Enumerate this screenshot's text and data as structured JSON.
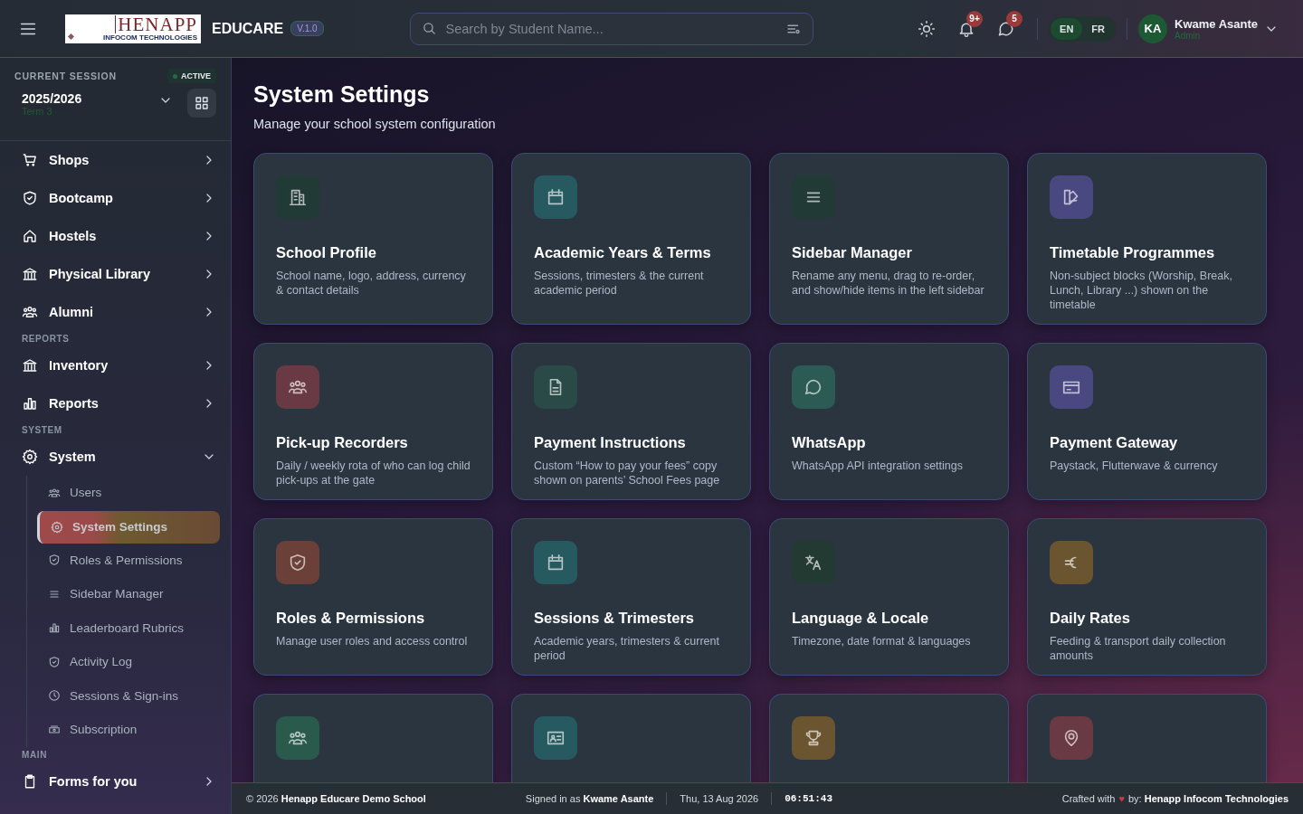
{
  "header": {
    "logo": {
      "title": "HENAPP",
      "subtitle": "INFOCOM TECHNOLOGIES"
    },
    "app_name": "EDUCARE",
    "version": "V.1.0",
    "search": {
      "placeholder": "Search by Student Name..."
    },
    "notifications": "9+",
    "messages": "5",
    "languages": [
      {
        "label": "EN",
        "selected": true
      },
      {
        "label": "FR",
        "selected": false
      }
    ],
    "user": {
      "initials": "KA",
      "name": "Kwame Asante",
      "role": "Admin"
    }
  },
  "sidebar": {
    "session": {
      "label": "CURRENT SESSION",
      "status": "ACTIVE",
      "year": "2025/2026",
      "term": "Term 3"
    },
    "nav": [
      {
        "kind": "item",
        "label": "Shops",
        "expanded": false
      },
      {
        "kind": "item",
        "label": "Bootcamp",
        "expanded": false
      },
      {
        "kind": "item",
        "label": "Hostels",
        "expanded": false
      },
      {
        "kind": "item",
        "label": "Physical Library",
        "expanded": false
      },
      {
        "kind": "item",
        "label": "Alumni",
        "expanded": false
      },
      {
        "kind": "section",
        "label": "REPORTS"
      },
      {
        "kind": "item",
        "label": "Inventory",
        "expanded": false
      },
      {
        "kind": "item",
        "label": "Reports",
        "expanded": false
      },
      {
        "kind": "section",
        "label": "SYSTEM"
      },
      {
        "kind": "item",
        "label": "System",
        "expanded": true,
        "children": [
          {
            "label": "Users",
            "selected": false
          },
          {
            "label": "System Settings",
            "selected": true
          },
          {
            "label": "Roles & Permissions",
            "selected": false
          },
          {
            "label": "Sidebar Manager",
            "selected": false
          },
          {
            "label": "Leaderboard Rubrics",
            "selected": false
          },
          {
            "label": "Activity Log",
            "selected": false
          },
          {
            "label": "Sessions & Sign-ins",
            "selected": false
          },
          {
            "label": "Subscription",
            "selected": false
          }
        ]
      },
      {
        "kind": "section",
        "label": "MAIN"
      },
      {
        "kind": "item",
        "label": "Forms for you",
        "expanded": false
      }
    ]
  },
  "page": {
    "title": "System Settings",
    "subtitle": "Manage your school system configuration"
  },
  "cards": [
    {
      "title": "School Profile",
      "description": "School name, logo, address, currency & contact details",
      "color": "#213a36"
    },
    {
      "title": "Academic Years & Terms",
      "description": "Sessions, trimesters & the current academic period",
      "color": "#265a60"
    },
    {
      "title": "Sidebar Manager",
      "description": "Rename any menu, drag to re-order, and show/hide items in the left sidebar",
      "color": "#213a36"
    },
    {
      "title": "Timetable Programmes",
      "description": "Non-subject blocks (Worship, Break, Lunch, Library ...) shown on the timetable",
      "color": "#4a4880"
    },
    {
      "title": "Pick-up Recorders",
      "description": "Daily / weekly rota of who can log child pick-ups at the gate",
      "color": "#6a3a44"
    },
    {
      "title": "Payment Instructions",
      "description": "Custom “How to pay your fees” copy shown on parents’ School Fees page",
      "color": "#294a46"
    },
    {
      "title": "WhatsApp",
      "description": "WhatsApp API integration settings",
      "color": "#2c5a54"
    },
    {
      "title": "Payment Gateway",
      "description": "Paystack, Flutterwave & currency",
      "color": "#4a4880"
    },
    {
      "title": "Roles & Permissions",
      "description": "Manage user roles and access control",
      "color": "#6a4038"
    },
    {
      "title": "Sessions & Trimesters",
      "description": "Academic years, trimesters & current period",
      "color": "#265a60"
    },
    {
      "title": "Language & Locale",
      "description": "Timezone, date format & languages",
      "color": "#223a32"
    },
    {
      "title": "Daily Rates",
      "description": "Feeding & transport daily collection amounts",
      "color": "#6b5530"
    },
    {
      "color": "#2a5a4c"
    },
    {
      "color": "#265a60"
    },
    {
      "color": "#6b5530"
    },
    {
      "color": "#6a3a44"
    }
  ],
  "footer": {
    "copyright": "© 2026 **Henapp Educare Demo School**",
    "signed_in": "Signed in as **Kwame Asante**",
    "date": "Thu, 13 Aug 2026",
    "time": "06:51:43",
    "crafted": "Crafted with",
    "heart": "♥",
    "credit": "by: **Henapp Infocom Technologies**"
  }
}
